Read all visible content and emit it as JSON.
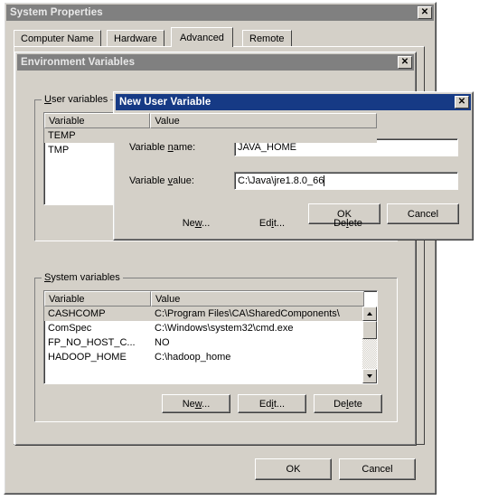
{
  "system_properties": {
    "title": "System Properties",
    "close_label": "✕",
    "tabs": [
      {
        "label": "Computer Name",
        "active": false
      },
      {
        "label": "Hardware",
        "active": false
      },
      {
        "label": "Advanced",
        "active": true
      },
      {
        "label": "Remote",
        "active": false
      }
    ],
    "ok_label": "OK",
    "cancel_label": "Cancel"
  },
  "environment_variables": {
    "title": "Environment Variables",
    "close_label": "✕",
    "user_group": {
      "label_pre": "",
      "label_mnemonic": "U",
      "label_post": "ser variables",
      "columns": [
        "Variable",
        "Value"
      ],
      "rows": [
        {
          "variable": "TEMP",
          "value": "",
          "selected": true
        },
        {
          "variable": "TMP",
          "value": "",
          "selected": false
        }
      ],
      "buttons": [
        {
          "pre": "Ne",
          "mn": "w",
          "post": "..."
        },
        {
          "pre": "Ed",
          "mn": "i",
          "post": "t..."
        },
        {
          "pre": "De",
          "mn": "l",
          "post": "ete"
        }
      ]
    },
    "system_group": {
      "label_mnemonic": "S",
      "label_post": "ystem variables",
      "columns": [
        "Variable",
        "Value"
      ],
      "rows": [
        {
          "variable": "CASHCOMP",
          "value": "C:\\Program Files\\CA\\SharedComponents\\",
          "selected": true
        },
        {
          "variable": "ComSpec",
          "value": "C:\\Windows\\system32\\cmd.exe",
          "selected": false
        },
        {
          "variable": "FP_NO_HOST_C...",
          "value": "NO",
          "selected": false
        },
        {
          "variable": "HADOOP_HOME",
          "value": "C:\\hadoop_home",
          "selected": false
        }
      ],
      "buttons": [
        {
          "pre": "Ne",
          "mn": "w",
          "post": "..."
        },
        {
          "pre": "Ed",
          "mn": "i",
          "post": "t..."
        },
        {
          "pre": "De",
          "mn": "l",
          "post": "ete"
        }
      ],
      "scroll_up": "▲",
      "scroll_down": "▼"
    }
  },
  "new_user_variable": {
    "title": "New User Variable",
    "close_label": "✕",
    "name_label_pre": "Variable ",
    "name_label_mn": "n",
    "name_label_post": "ame:",
    "name_value": "JAVA_HOME",
    "value_label_pre": "Variable ",
    "value_label_mn": "v",
    "value_label_post": "alue:",
    "value_value": "C:\\Java\\jre1.8.0_66",
    "ok_label": "OK",
    "cancel_label": "Cancel"
  },
  "colors": {
    "face": "#d4d0c8",
    "title_inactive": "#808080",
    "title_active": "#163a85",
    "shadow": "#808080",
    "dark": "#404040",
    "light": "#ffffff",
    "window": "#ffffff"
  }
}
